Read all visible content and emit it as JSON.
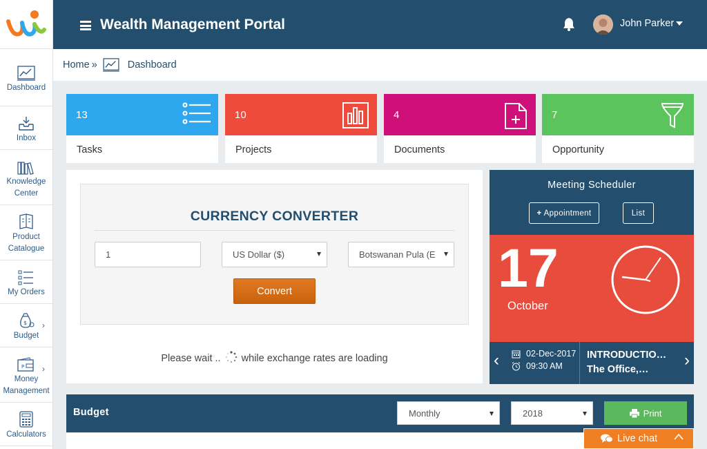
{
  "header": {
    "title": "Wealth Management Portal",
    "user_name": "John Parker"
  },
  "breadcrumb": {
    "home": "Home",
    "separator": "»",
    "current": "Dashboard"
  },
  "sidebar": {
    "items": [
      {
        "label_lines": [
          "Dashboard"
        ],
        "icon": "dashboard-chart-icon"
      },
      {
        "label_lines": [
          "Inbox"
        ],
        "icon": "inbox-icon"
      },
      {
        "label_lines": [
          "Knowledge",
          "Center"
        ],
        "icon": "books-icon"
      },
      {
        "label_lines": [
          "Product",
          "Catalogue"
        ],
        "icon": "catalogue-icon"
      },
      {
        "label_lines": [
          "My Orders"
        ],
        "icon": "orders-list-icon"
      },
      {
        "label_lines": [
          "Budget"
        ],
        "icon": "money-bag-icon",
        "submenu": true
      },
      {
        "label_lines": [
          "Money",
          "Management"
        ],
        "icon": "wallet-icon",
        "submenu": true
      },
      {
        "label_lines": [
          "Calculators"
        ],
        "icon": "calculator-icon"
      }
    ]
  },
  "cards": [
    {
      "count": "13",
      "label": "Tasks",
      "color": "#2ea7ee",
      "icon": "list-icon"
    },
    {
      "count": "10",
      "label": "Projects",
      "color": "#ef4b3c",
      "icon": "bar-chart-icon"
    },
    {
      "count": "4",
      "label": "Documents",
      "color": "#d0107a",
      "icon": "document-add-icon"
    },
    {
      "count": "7",
      "label": "Opportunity",
      "color": "#5cc45c",
      "icon": "funnel-icon"
    }
  ],
  "currency": {
    "title": "CURRENCY CONVERTER",
    "amount": "1",
    "from_currency": "US Dollar ($)",
    "to_currency": "Botswanan Pula (E",
    "convert_label": "Convert",
    "loading_before": "Please wait ..",
    "loading_after": "while exchange rates are loading"
  },
  "meeting": {
    "title": "Meeting Scheduler",
    "appointment_label": "Appointment",
    "list_label": "List",
    "day": "17",
    "month": "October",
    "event_date": "02-Dec-2017",
    "event_time": "09:30 AM",
    "event_title": "INTRODUCTIO…",
    "event_location": "The Office,…"
  },
  "budget": {
    "title": "Budget",
    "period": "Monthly",
    "year": "2018",
    "print_label": "Print"
  },
  "livechat": {
    "label": "Live chat"
  },
  "colors": {
    "primary": "#234e6e",
    "accent_orange": "#e07a22",
    "meeting_red": "#e74c3c",
    "print_green": "#5cb85c"
  }
}
